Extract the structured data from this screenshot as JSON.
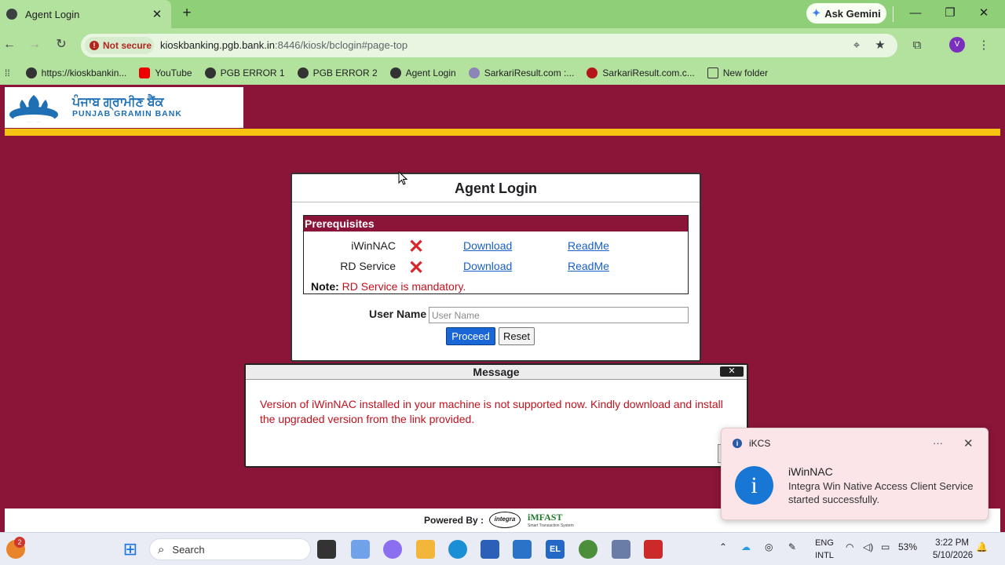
{
  "browser": {
    "tab_title": "Agent Login",
    "gemini_label": "Ask Gemini",
    "not_secure_label": "Not secure",
    "url_host": "kioskbanking.pgb.bank.in",
    "url_path": ":8446/kiosk/bclogin#page-top",
    "avatar_letter": "V"
  },
  "bookmarks": [
    {
      "label": "https://kioskbankin...",
      "icon": "globe-icon"
    },
    {
      "label": "YouTube",
      "icon": "youtube-icon"
    },
    {
      "label": "PGB ERROR 1",
      "icon": "globe-icon"
    },
    {
      "label": "PGB ERROR 2",
      "icon": "globe-icon"
    },
    {
      "label": "Agent Login",
      "icon": "globe-icon"
    },
    {
      "label": "SarkariResult.com :...",
      "icon": "site-icon"
    },
    {
      "label": "SarkariResult.com.c...",
      "icon": "site-icon"
    },
    {
      "label": "New folder",
      "icon": "folder-icon"
    }
  ],
  "bank": {
    "name_hindi": "ਪੰਜਾਬ ਗ੍ਰਾਮੀਣ ਬੈਂਕ",
    "name_english": "PUNJAB GRAMIN BANK",
    "brand_color": "#8a1538",
    "accent_color": "#f7c313"
  },
  "login": {
    "title": "Agent Login",
    "prereq_header": "Prerequisites",
    "prereqs": [
      {
        "name": "iWinNAC",
        "status_icon": "red-x-icon",
        "download": "Download",
        "readme": "ReadMe"
      },
      {
        "name": "RD Service",
        "status_icon": "red-x-icon",
        "download": "Download",
        "readme": "ReadMe"
      }
    ],
    "note_label": "Note:",
    "note_text": "RD Service is mandatory.",
    "username_label": "User Name",
    "username_placeholder": "User Name",
    "username_value": "",
    "proceed_label": "Proceed",
    "reset_label": "Reset"
  },
  "message": {
    "title": "Message",
    "close_glyph": "✕",
    "text": "Version of iWinNAC installed in your machine is not supported now. Kindly download and install the upgraded version from the link provided."
  },
  "footer": {
    "powered_by": "Powered By :",
    "integra": "integra",
    "imfast": "iMFAST",
    "imfast_sub": "Smart Transaction System"
  },
  "notification": {
    "app": "iKCS",
    "more_glyph": "···",
    "title": "iWinNAC",
    "body": "Integra Win Native Access Client Service started successfully."
  },
  "taskbar": {
    "search_label": "Search",
    "weather_badge": "2",
    "lang_line1": "ENG",
    "lang_line2": "INTL",
    "battery": "53%",
    "time": "3:22 PM",
    "date": "5/10/2026"
  }
}
